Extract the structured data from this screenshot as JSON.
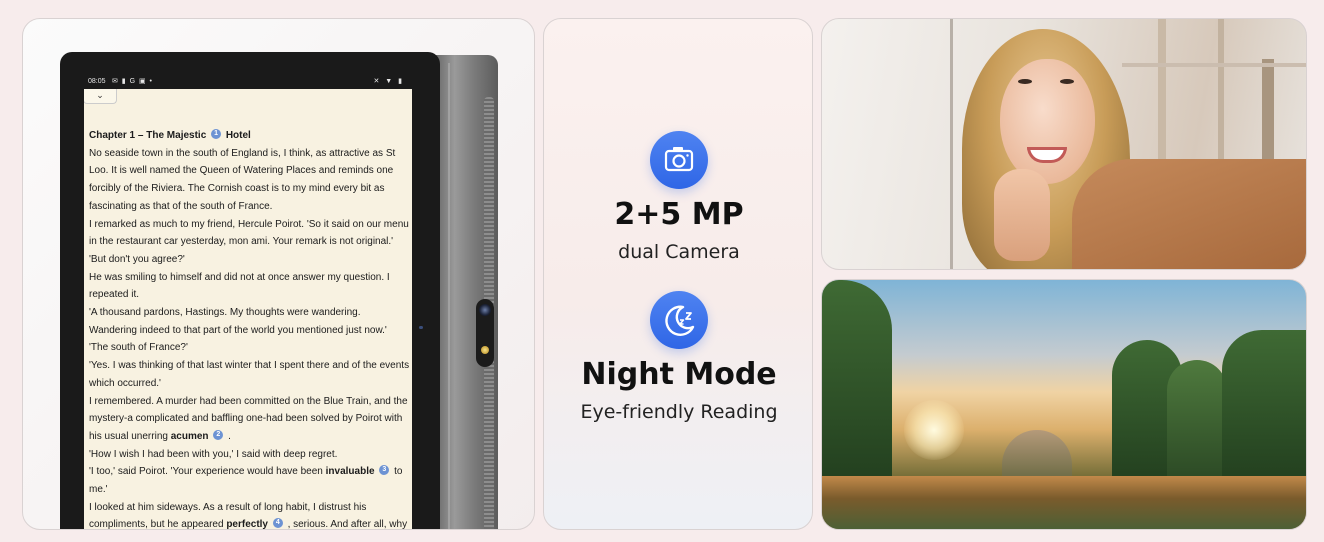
{
  "tablet": {
    "status": {
      "time": "08:05",
      "left_icons": "✉ ▮ G ▣ •",
      "right_icons": "✕ ▼ ▮"
    },
    "chevron": "⌄",
    "book": {
      "chapter_title": "Chapter 1 – The Majestic",
      "chapter_badge": "1",
      "chapter_title_end": "Hotel",
      "p1": "No seaside town in the south of England is, I think, as attractive as St Loo. It is well named the Queen of Watering Places and reminds one forcibly of the Riviera. The Cornish coast is to my mind every bit as fascinating as that of the south of France.",
      "p2": "I remarked as much to my friend, Hercule Poirot. 'So it said on our menu in the restaurant car yesterday, mon ami. Your remark is not original.'",
      "p3": "'But don't you agree?'",
      "p4": "He was smiling to himself and did not at once answer my question. I repeated it.",
      "p5": "'A thousand pardons, Hastings. My thoughts were wandering. Wandering indeed to that part of the world you mentioned just now.'",
      "p6": "'The south of France?'",
      "p7": "'Yes. I was thinking of that last winter that I spent there and of the events which occurred.'",
      "p8_start": "I remembered. A murder had been committed on the Blue Train, and the mystery-a complicated and baffling one-had been solved by Poirot with his usual unerring",
      "p8_bold": "acumen",
      "p8_badge": "2",
      "p8_end": ".",
      "p9": "'How I wish I had been with you,' I said with deep regret.",
      "p10_start": "'I too,' said Poirot. 'Your experience would have been",
      "p10_bold": "invaluable",
      "p10_badge": "3",
      "p10_end": "to me.'",
      "p11": "I looked at him sideways. As a result of long habit, I distrust his",
      "p12_start": "compliments, but he appeared",
      "p12_bold": "perfectly",
      "p12_badge": "4",
      "p12_end": ", serious. And after all, why"
    }
  },
  "features": {
    "camera": {
      "icon": "camera-icon",
      "title": "2+5 MP",
      "subtitle": "dual Camera"
    },
    "night": {
      "icon": "moon-icon",
      "title": "Night Mode",
      "subtitle": "Eye-friendly Reading"
    }
  },
  "colors": {
    "accent": "#3a6fe8",
    "screen_bg": "#f8f2e1",
    "badge": "#6d93d3"
  }
}
